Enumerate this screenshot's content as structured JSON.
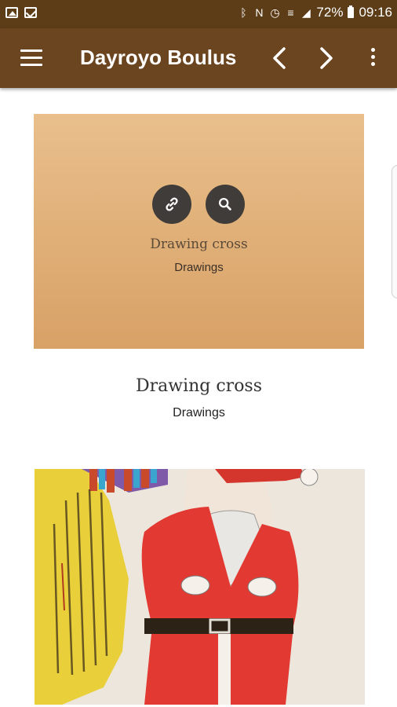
{
  "status_bar": {
    "battery_percent": "72%",
    "time": "09:16",
    "left_icons": [
      "image-icon",
      "mail-icon"
    ],
    "right_icons": [
      "bluetooth-icon",
      "nfc-icon",
      "alarm-icon",
      "wifi-icon",
      "signal-icon",
      "battery-icon"
    ]
  },
  "app_bar": {
    "title": "Dayroyo Boulus",
    "icons": [
      "menu-icon",
      "chevron-left-icon",
      "chevron-right-icon",
      "more-vert-icon"
    ]
  },
  "gallery": {
    "items": [
      {
        "overlay_title": "Drawing cross",
        "overlay_category": "Drawings",
        "title": "Drawing cross",
        "category": "Drawings",
        "actions": [
          "link-icon",
          "search-icon"
        ]
      },
      {
        "image": "santa-claus-drawing"
      }
    ]
  },
  "colors": {
    "status_bar": "#5d3d18",
    "app_bar": "#6a4520",
    "card_top": "#e9bf8c",
    "card_bottom": "#d8a166",
    "action_button": "#3f3c39"
  }
}
